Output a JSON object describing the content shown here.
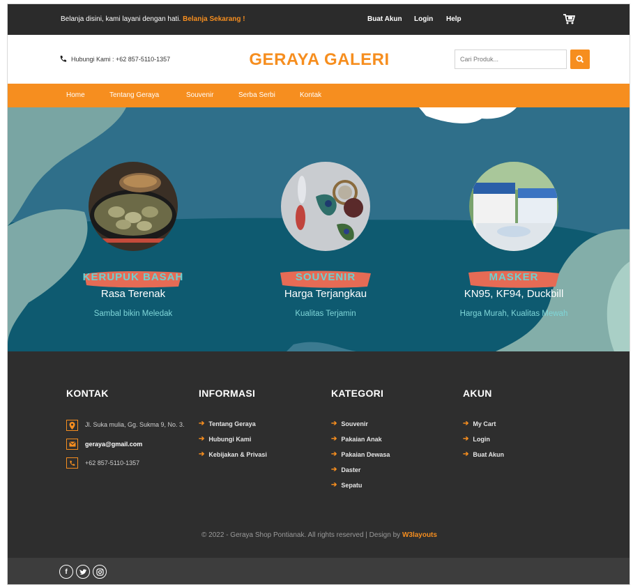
{
  "topbar": {
    "promo_text": "Belanja disini, kami layani dengan hati.",
    "promo_link": "Belanja Sekarang !",
    "links": [
      "Buat Akun",
      "Login",
      "Help"
    ]
  },
  "header": {
    "phone": "Hubungi Kami : +62 857-5110-1357",
    "brand": "GERAYA GALERI",
    "search_placeholder": "Cari Produk..."
  },
  "nav": [
    "Home",
    "Tentang Geraya",
    "Souvenir",
    "Serba Serbi",
    "Kontak"
  ],
  "hero": {
    "items": [
      {
        "title": "KERUPUK BASAH",
        "subtitle": "Rasa Terenak",
        "desc": "Sambal bikin Meledak"
      },
      {
        "title": "SOUVENIR",
        "subtitle": "Harga Terjangkau",
        "desc": "Kualitas Terjamin"
      },
      {
        "title": "MASKER",
        "subtitle": "KN95, KF94, Duckbill",
        "desc": "Harga Murah, Kualitas Mewah"
      }
    ]
  },
  "footer": {
    "kontak": {
      "title": "KONTAK",
      "address": "Jl. Suka mulia, Gg. Sukma 9, No. 3.",
      "email": "geraya@gmail.com",
      "phone": "+62 857-5110-1357"
    },
    "informasi": {
      "title": "INFORMASI",
      "items": [
        "Tentang Geraya",
        "Hubungi Kami",
        "Kebijakan & Privasi"
      ]
    },
    "kategori": {
      "title": "KATEGORI",
      "items": [
        "Souvenir",
        "Pakaian Anak",
        "Pakaian Dewasa",
        "Daster",
        "Sepatu"
      ]
    },
    "akun": {
      "title": "AKUN",
      "items": [
        "My Cart",
        "Login",
        "Buat Akun"
      ]
    },
    "copyright": "© 2022 - Geraya Shop Pontianak. All rights reserved | Design by",
    "designer": "W3layouts"
  },
  "colors": {
    "accent": "#f68e1f",
    "dark": "#2e2e2e",
    "hero_bg": "#0e5a70",
    "hero_text": "#6ed0d0"
  },
  "icons": [
    "cart-icon",
    "phone-icon",
    "search-icon",
    "location-icon",
    "mail-icon",
    "facebook-icon",
    "twitter-icon",
    "instagram-icon"
  ]
}
